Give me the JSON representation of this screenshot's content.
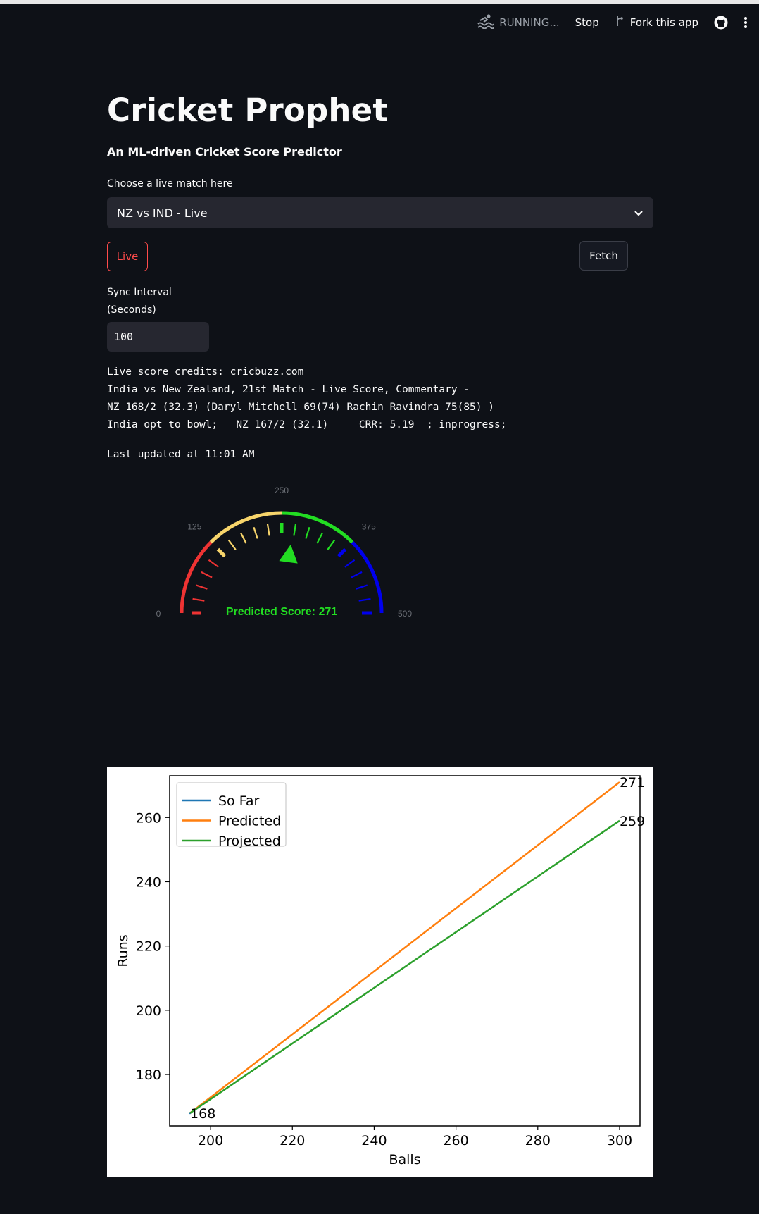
{
  "toolbar": {
    "status": "RUNNING...",
    "stop_label": "Stop",
    "fork_label": "Fork this app"
  },
  "header": {
    "title": "Cricket Prophet",
    "subtitle": "An ML-driven Cricket Score Predictor"
  },
  "match_select": {
    "label": "Choose a live match here",
    "value": "NZ vs IND - Live"
  },
  "buttons": {
    "live": "Live",
    "fetch": "Fetch"
  },
  "sync": {
    "label_line1": "Sync Interval",
    "label_line2": "(Seconds)",
    "value": "100"
  },
  "score_info": {
    "credits": "Live score credits: cricbuzz.com",
    "line1": "India vs New Zealand, 21st Match - Live Score, Commentary -",
    "line2": "NZ 168/2 (32.3) (Daryl Mitchell 69(74) Rachin Ravindra 75(85) )",
    "line3": "India opt to bowl;   NZ 167/2 (32.1)     CRR: 5.19  ; inprogress;",
    "last_updated": "Last updated at 11:01 AM"
  },
  "gauge": {
    "min": 0,
    "max": 500,
    "value": 271,
    "tick_labels": [
      "0",
      "125",
      "250",
      "375",
      "500"
    ],
    "label": "Predicted Score: 271",
    "colors": {
      "low": "#ee3333",
      "mid": "#f7d56b",
      "good": "#22dd22",
      "high": "#0000ee"
    }
  },
  "chart_data": {
    "type": "line",
    "xlabel": "Balls",
    "ylabel": "Runs",
    "xlim": [
      190,
      305
    ],
    "ylim": [
      164,
      273
    ],
    "xticks": [
      200,
      220,
      240,
      260,
      280,
      300
    ],
    "yticks": [
      180,
      200,
      220,
      240,
      260
    ],
    "legend_position": "top-left",
    "series": [
      {
        "name": "So Far",
        "color": "#1f77b4",
        "x": [
          195
        ],
        "y": [
          168
        ]
      },
      {
        "name": "Predicted",
        "color": "#ff7f0e",
        "x": [
          195,
          300
        ],
        "y": [
          168,
          271
        ]
      },
      {
        "name": "Projected",
        "color": "#2ca02c",
        "x": [
          195,
          300
        ],
        "y": [
          168,
          259
        ]
      }
    ],
    "annotations": [
      {
        "text": "168",
        "x": 195,
        "y": 168
      },
      {
        "text": "271",
        "x": 300,
        "y": 271
      },
      {
        "text": "259",
        "x": 300,
        "y": 259
      }
    ]
  }
}
